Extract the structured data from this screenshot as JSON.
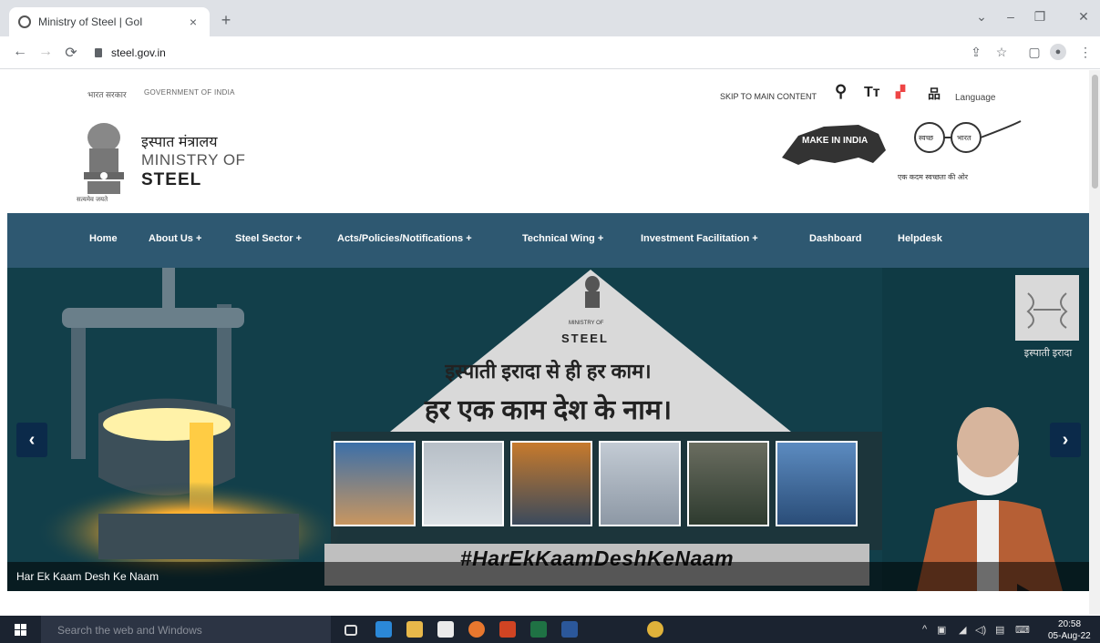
{
  "browser": {
    "tab_title": "Ministry of Steel | GoI",
    "tab_close": "×",
    "new_tab": "+",
    "url": "steel.gov.in",
    "window_controls": {
      "chevron": "⌄",
      "minimize": "–",
      "restore": "❐",
      "close": "✕"
    }
  },
  "site": {
    "gov_hindi": "भारत सरकार",
    "gov_english": "GOVERNMENT OF INDIA",
    "skip_link": "SKIP TO MAIN CONTENT",
    "language": "Language",
    "ministry_hindi": "इस्पात मंत्रालय",
    "ministry_en_line1": "MINISTRY OF",
    "ministry_en_line2": "STEEL",
    "emblem_caption": "सत्यमेव जयते",
    "make_in_india": "MAKE IN INDIA",
    "swachh_caption": "एक कदम स्वच्छता की ओर",
    "swachh_left": "स्वच्छ",
    "swachh_right": "भारत"
  },
  "nav": {
    "items": [
      "Home",
      "About Us +",
      "Steel Sector +",
      "Acts/Policies/Notifications +",
      "Technical Wing +",
      "Investment Facilitation +",
      "Dashboard",
      "Helpdesk"
    ]
  },
  "carousel": {
    "ministry_small": "MINISTRY OF",
    "steel_label": "STEEL",
    "line1": "इस्पाती इरादा से ही हर काम।",
    "line2": "हर एक काम देश के नाम।",
    "hashtag": "#HarEkKaamDeshKeNaam",
    "caption": "Har Ek Kaam Desh Ke Naam",
    "ispati_caption": "इस्पाती इरादा",
    "prev": "‹",
    "next": "›"
  },
  "taskbar": {
    "search_placeholder": "Search the web and Windows",
    "time": "20:58",
    "date": "05-Aug-22"
  }
}
